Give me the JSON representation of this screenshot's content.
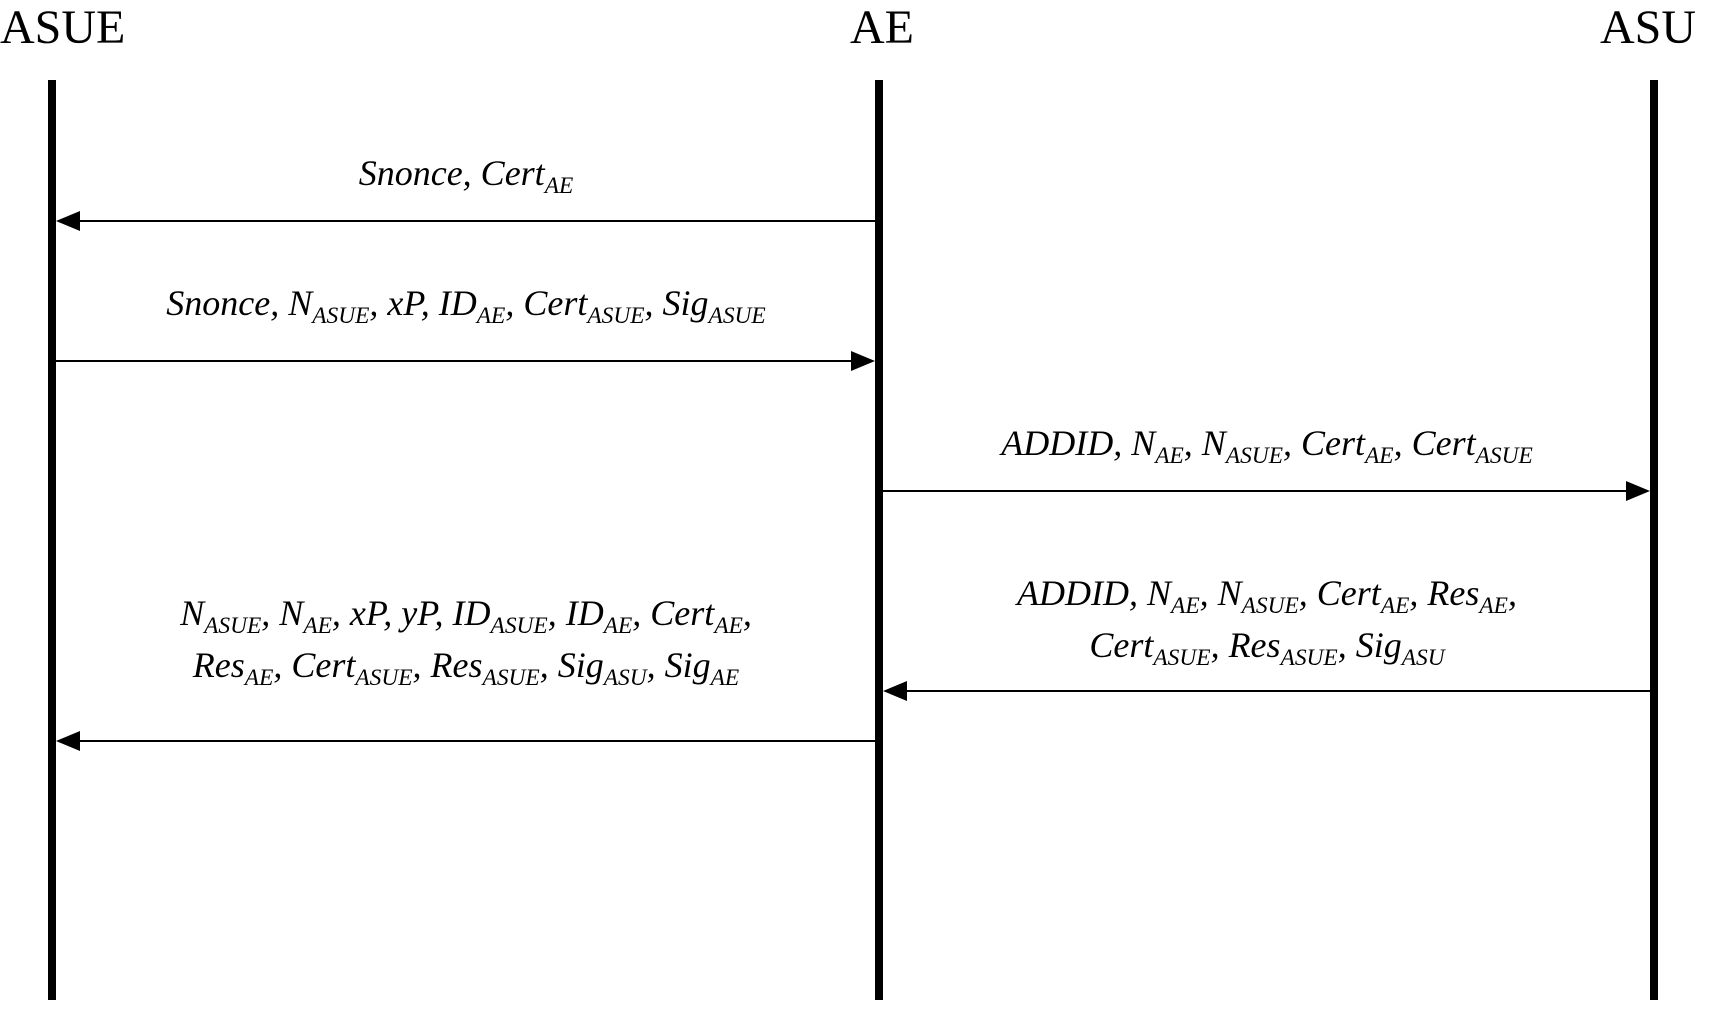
{
  "participants": {
    "asue": "ASUE",
    "ae": "AE",
    "asu": "ASU"
  },
  "messages": {
    "m1": {
      "text": "Snonce, Cert",
      "sub1": "AE"
    },
    "m2": {
      "text": "Snonce, N",
      "sub1": "ASUE",
      "text2": ", xP, ID",
      "sub2": "AE",
      "text3": ", Cert",
      "sub3": "ASUE",
      "text4": ", Sig",
      "sub4": "ASUE"
    },
    "m3": {
      "text": "ADDID, N",
      "sub1": "AE",
      "text2": ", N",
      "sub2": "ASUE",
      "text3": ", Cert",
      "sub3": "AE",
      "text4": ", Cert",
      "sub4": "ASUE"
    },
    "m4": {
      "line1_text": "ADDID, N",
      "line1_sub1": "AE",
      "line1_text2": ", N",
      "line1_sub2": "ASUE",
      "line1_text3": ", Cert",
      "line1_sub3": "AE",
      "line1_text4": ", Res",
      "line1_sub4": "AE",
      "line1_text5": ",",
      "line2_text": "Cert",
      "line2_sub1": "ASUE",
      "line2_text2": ", Res",
      "line2_sub2": "ASUE",
      "line2_text3": ", Sig",
      "line2_sub3": "ASU"
    },
    "m5": {
      "line1_text": "N",
      "line1_sub1": "ASUE",
      "line1_text2": ", N",
      "line1_sub2": "AE",
      "line1_text3": ", xP, yP, ID",
      "line1_sub3": "ASUE",
      "line1_text4": ", ID",
      "line1_sub4": "AE",
      "line1_text5": ", Cert",
      "line1_sub5": "AE",
      "line1_text6": ",",
      "line2_text": "Res",
      "line2_sub1": "AE",
      "line2_text2": ", Cert",
      "line2_sub2": "ASUE",
      "line2_text3": ", Res",
      "line2_sub3": "ASUE",
      "line2_text4": ",  Sig",
      "line2_sub4": "ASU",
      "line2_text5": ", Sig",
      "line2_sub5": "AE"
    }
  }
}
